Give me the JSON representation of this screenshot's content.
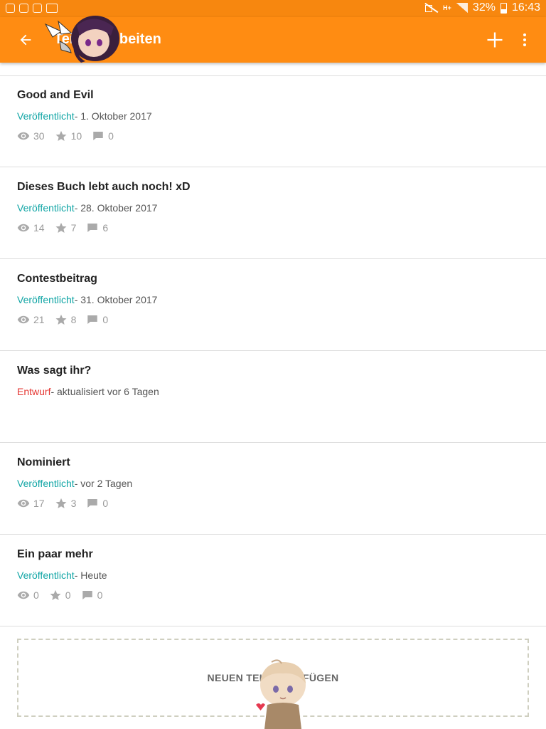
{
  "status_bar": {
    "battery_percent": "32%",
    "time": "16:43",
    "network": "H+"
  },
  "app_bar": {
    "title": "Teile bearbeiten",
    "back_icon": "arrow-back-icon",
    "add_icon": "plus-icon",
    "more_icon": "more-vert-icon"
  },
  "parts": [
    {
      "title": "Good and Evil",
      "status": "Veröffentlicht",
      "status_type": "published",
      "detail": "- 1. Oktober 2017",
      "views": "30",
      "votes": "10",
      "comments": "0",
      "show_stats": true
    },
    {
      "title": "Dieses Buch lebt auch noch! xD",
      "status": "Veröffentlicht",
      "status_type": "published",
      "detail": "- 28. Oktober 2017",
      "views": "14",
      "votes": "7",
      "comments": "6",
      "show_stats": true
    },
    {
      "title": "Contestbeitrag",
      "status": "Veröffentlicht",
      "status_type": "published",
      "detail": "- 31. Oktober 2017",
      "views": "21",
      "votes": "8",
      "comments": "0",
      "show_stats": true
    },
    {
      "title": "Was sagt ihr?",
      "status": "Entwurf",
      "status_type": "draft",
      "detail": "- aktualisiert vor 6 Tagen",
      "views": "",
      "votes": "",
      "comments": "",
      "show_stats": false
    },
    {
      "title": "Nominiert",
      "status": "Veröffentlicht",
      "status_type": "published",
      "detail": "- vor 2 Tagen",
      "views": "17",
      "votes": "3",
      "comments": "0",
      "show_stats": true
    },
    {
      "title": "Ein paar mehr",
      "status": "Veröffentlicht",
      "status_type": "published",
      "detail": "- Heute",
      "views": "0",
      "votes": "0",
      "comments": "0",
      "show_stats": true
    }
  ],
  "new_part": {
    "label": "NEUEN TEIL HINZUFÜGEN"
  },
  "colors": {
    "status_bar": "#f7870f",
    "app_bar": "#ff8c12",
    "published": "#10a5a5",
    "draft": "#e53935",
    "divider": "#dddddd"
  }
}
